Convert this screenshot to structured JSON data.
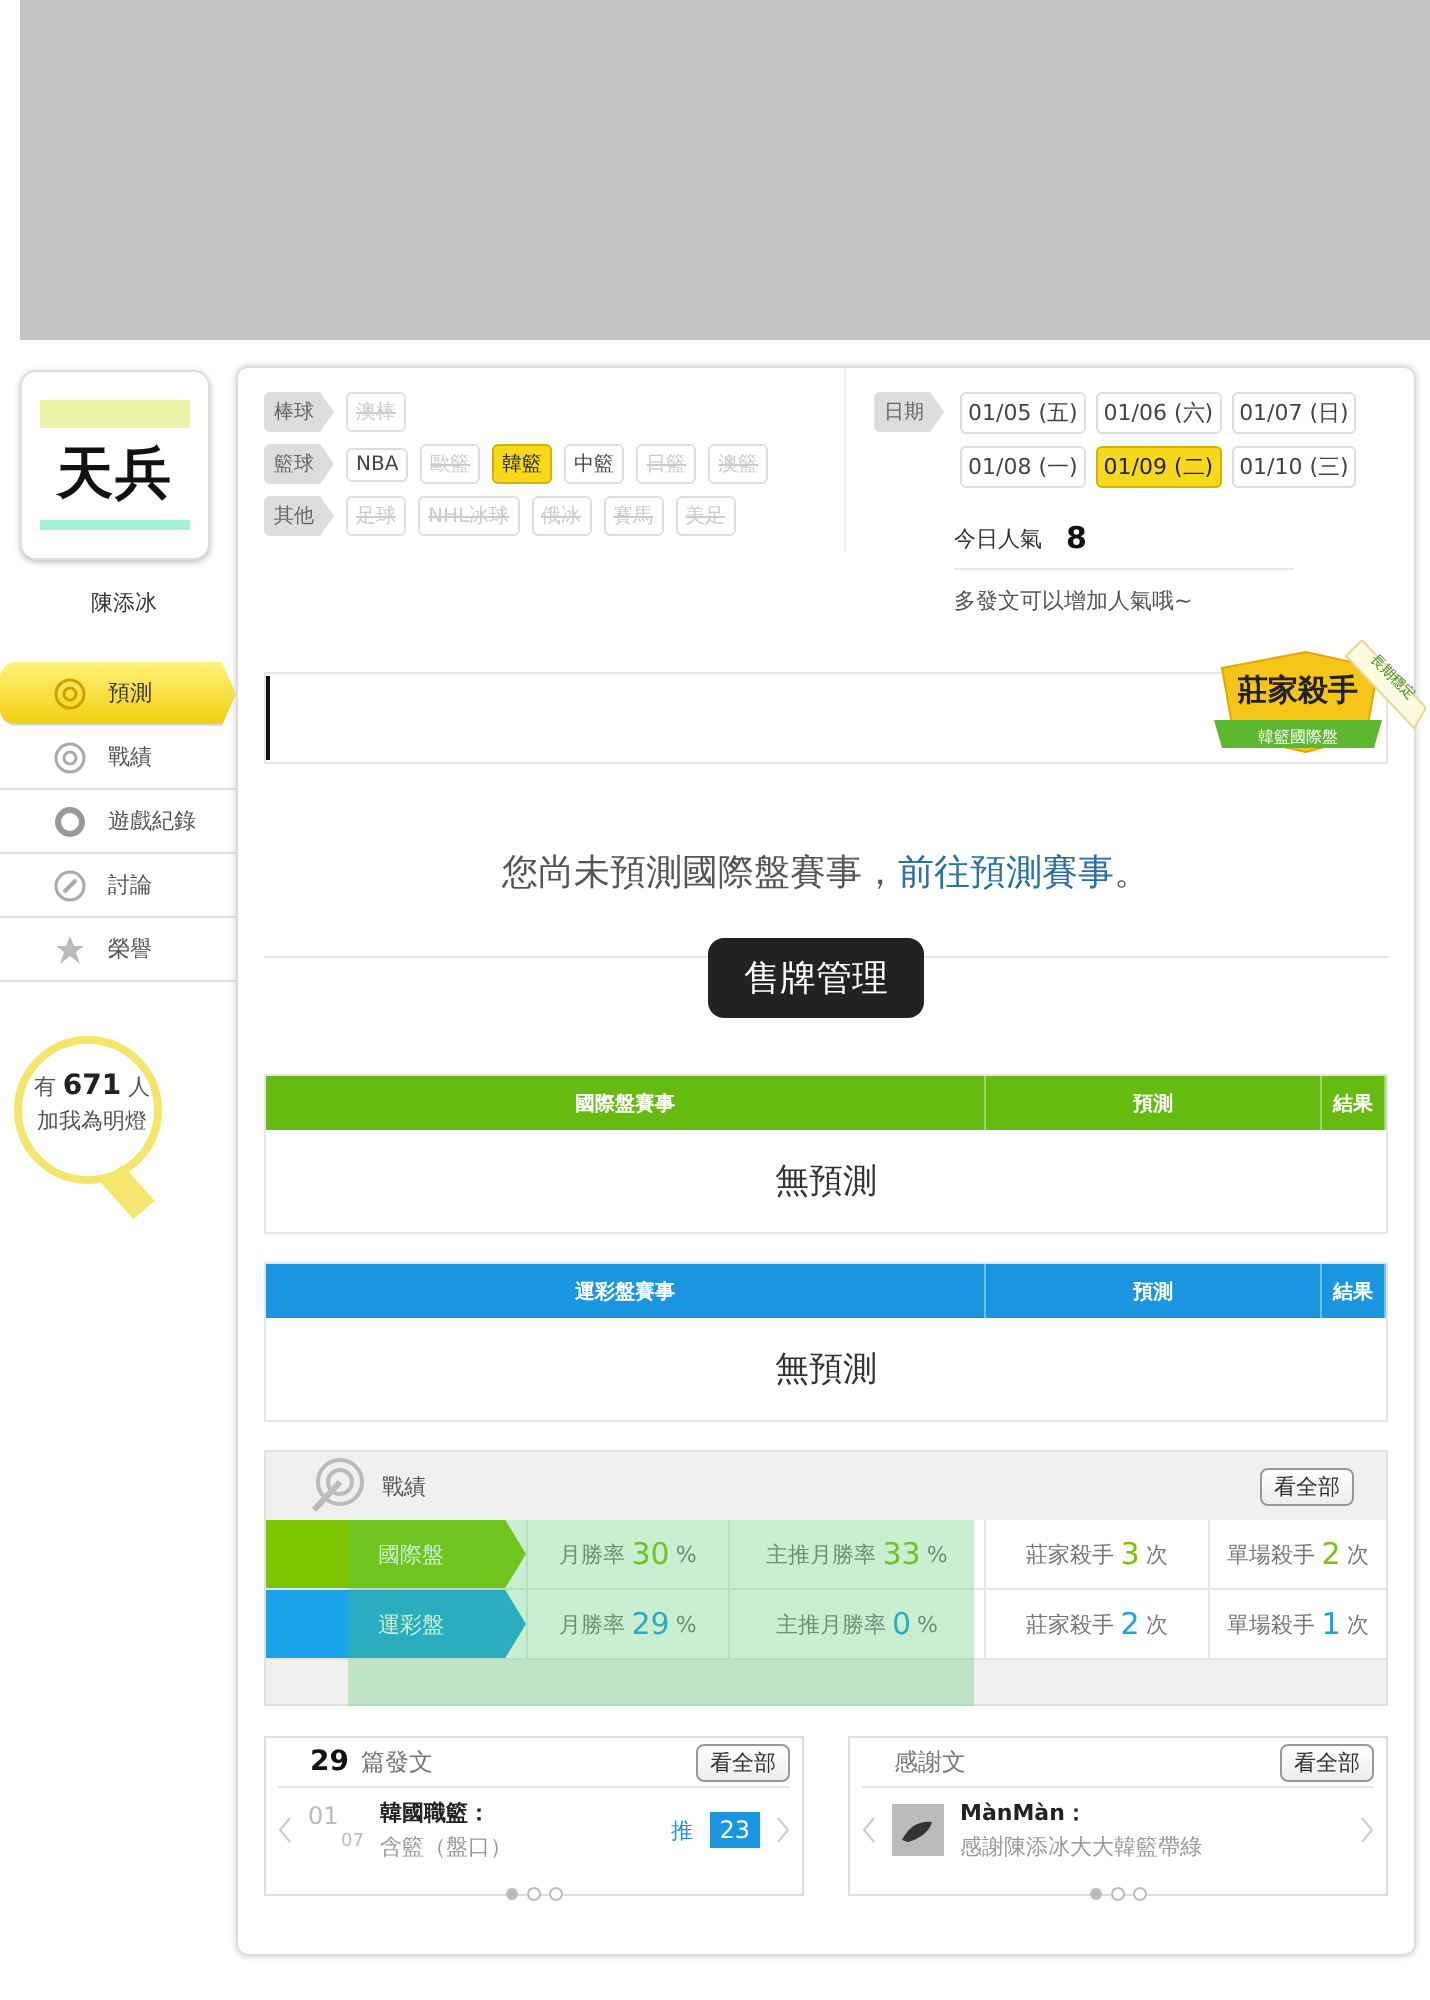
{
  "profile": {
    "logo": "天兵",
    "name": "陳添冰"
  },
  "nav": [
    {
      "label": "預測",
      "selected": true
    },
    {
      "label": "戰績",
      "selected": false
    },
    {
      "label": "遊戲紀錄",
      "selected": false
    },
    {
      "label": "討論",
      "selected": false
    },
    {
      "label": "榮譽",
      "selected": false
    }
  ],
  "fans": {
    "prefix": "有",
    "count": "671",
    "suffix": "人",
    "caption": "加我為明燈"
  },
  "sports": [
    {
      "label": "棒球",
      "options": [
        {
          "label": "澳棒",
          "disabled": true,
          "selected": false
        }
      ]
    },
    {
      "label": "籃球",
      "options": [
        {
          "label": "NBA",
          "disabled": false,
          "selected": false
        },
        {
          "label": "歐籃",
          "disabled": true,
          "selected": false
        },
        {
          "label": "韓籃",
          "disabled": false,
          "selected": true
        },
        {
          "label": "中籃",
          "disabled": false,
          "selected": false
        },
        {
          "label": "日籃",
          "disabled": true,
          "selected": false
        },
        {
          "label": "澳籃",
          "disabled": true,
          "selected": false
        }
      ]
    },
    {
      "label": "其他",
      "options": [
        {
          "label": "足球",
          "disabled": true,
          "selected": false
        },
        {
          "label": "NHL冰球",
          "disabled": true,
          "selected": false
        },
        {
          "label": "俄冰",
          "disabled": true,
          "selected": false
        },
        {
          "label": "賽馬",
          "disabled": true,
          "selected": false
        },
        {
          "label": "美足",
          "disabled": true,
          "selected": false
        }
      ]
    }
  ],
  "dates": {
    "label": "日期",
    "items": [
      {
        "label": "01/05 (五)",
        "selected": false
      },
      {
        "label": "01/06 (六)",
        "selected": false
      },
      {
        "label": "01/07 (日)",
        "selected": false
      },
      {
        "label": "01/08 (一)",
        "selected": false
      },
      {
        "label": "01/09 (二)",
        "selected": true
      },
      {
        "label": "01/10 (三)",
        "selected": false
      }
    ]
  },
  "popularity": {
    "label": "今日人氣",
    "value": "8",
    "hint": "多發文可以增加人氣哦~"
  },
  "badge": {
    "title": "莊家殺手",
    "subtitle": "韓籃國際盤",
    "ribbon": "長期穩定"
  },
  "message": {
    "text": "您尚未預測國際盤賽事，",
    "link": "前往預測賽事",
    "end": "。"
  },
  "tooltip": "售牌管理",
  "tables": [
    {
      "color": "#66bb11",
      "columns": [
        "國際盤賽事",
        "預測",
        "結果"
      ],
      "empty": "無預測"
    },
    {
      "color": "#1a96e0",
      "columns": [
        "運彩盤賽事",
        "預測",
        "結果"
      ],
      "empty": "無預測"
    }
  ],
  "record": {
    "title": "戰績",
    "view_all": "看全部",
    "rows": [
      {
        "label": "國際盤",
        "color": "#7dc400",
        "cells": [
          {
            "label": "月勝率",
            "value": "30",
            "unit": "%"
          },
          {
            "label": "主推月勝率",
            "value": "33",
            "unit": "%"
          },
          {
            "label": "莊家殺手",
            "value": "3",
            "unit": "次"
          },
          {
            "label": "單場殺手",
            "value": "2",
            "unit": "次"
          }
        ]
      },
      {
        "label": "運彩盤",
        "color": "#1aa3e6",
        "cells": [
          {
            "label": "月勝率",
            "value": "29",
            "unit": "%"
          },
          {
            "label": "主推月勝率",
            "value": "0",
            "unit": "%"
          },
          {
            "label": "莊家殺手",
            "value": "2",
            "unit": "次"
          },
          {
            "label": "單場殺手",
            "value": "1",
            "unit": "次"
          }
        ]
      }
    ]
  },
  "posts": {
    "count": "29",
    "label": "篇發文",
    "view_all": "看全部",
    "month": "01",
    "day": "07",
    "title": "韓國職籃：",
    "subtitle": "含籃（盤口）",
    "push_label": "推",
    "push_count": "23"
  },
  "thanks": {
    "title": "感謝文",
    "view_all": "看全部",
    "author": "MànMàn：",
    "text": "感謝陳添冰大大韓籃帶綠"
  }
}
